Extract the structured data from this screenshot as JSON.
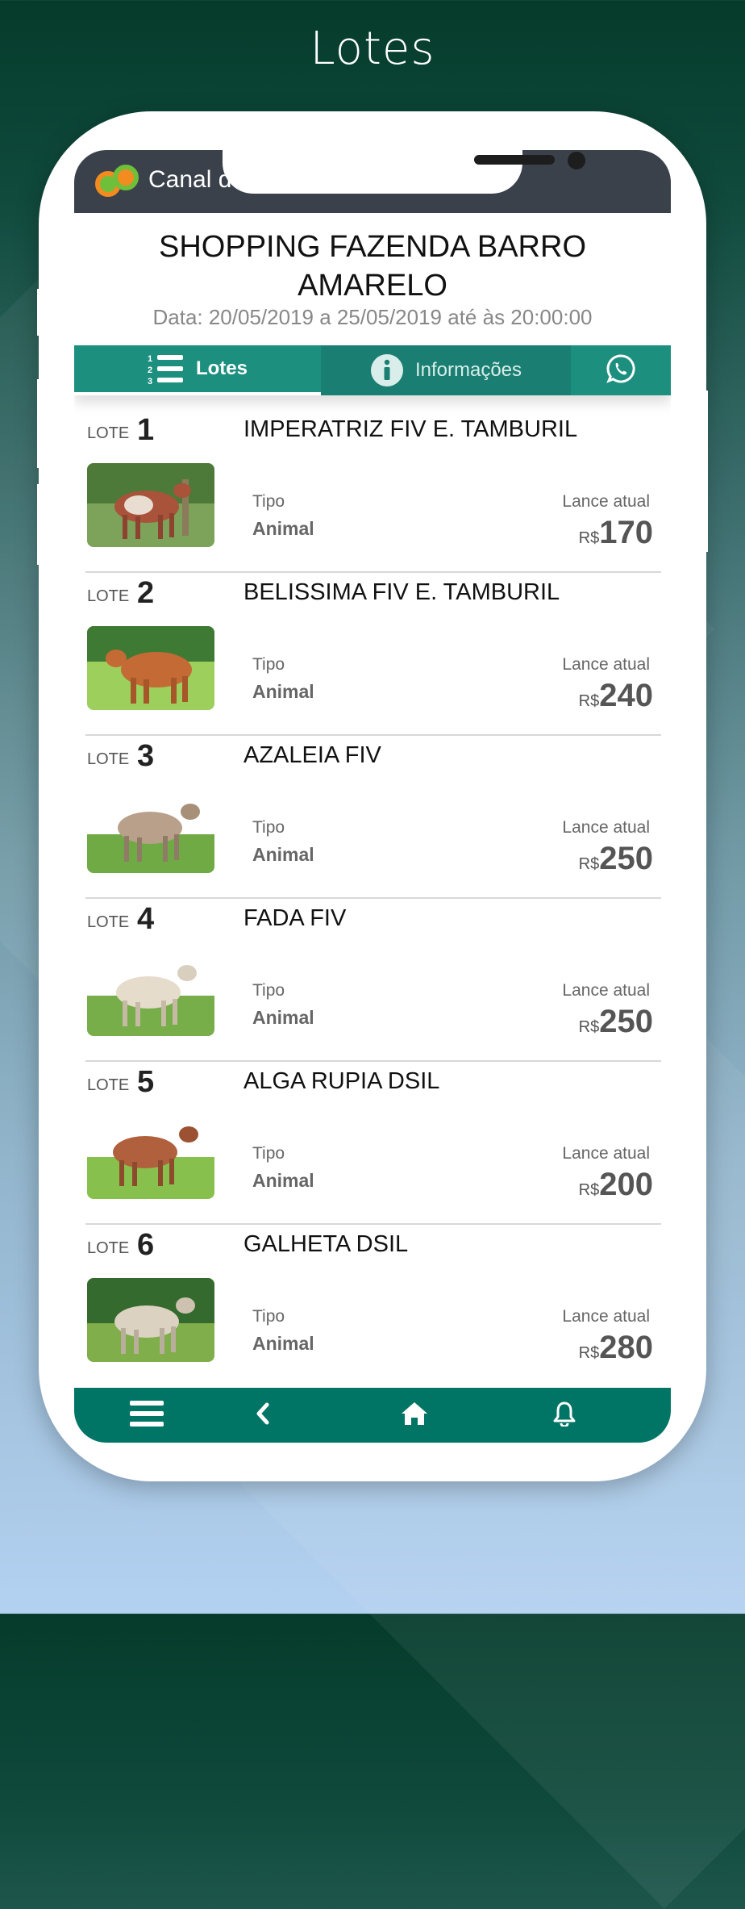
{
  "page_title": "Lotes",
  "app": {
    "name": "Canal do Leilão"
  },
  "auction": {
    "title": "SHOPPING FAZENDA BARRO AMARELO",
    "date": "Data: 20/05/2019 a 25/05/2019 até às 20:00:00"
  },
  "tabs": {
    "lotes": "Lotes",
    "informacoes": "Informações"
  },
  "lot_common": {
    "lote_label": "LOTE",
    "tipo_label": "Tipo",
    "lance_label": "Lance atual",
    "currency": "R$"
  },
  "lots": [
    {
      "number": "1",
      "name": "IMPERATRIZ FIV E. TAMBURIL",
      "tipo": "Animal",
      "price": "170"
    },
    {
      "number": "2",
      "name": "BELISSIMA FIV E. TAMBURIL",
      "tipo": "Animal",
      "price": "240"
    },
    {
      "number": "3",
      "name": "AZALEIA FIV",
      "tipo": "Animal",
      "price": "250"
    },
    {
      "number": "4",
      "name": "FADA FIV",
      "tipo": "Animal",
      "price": "250"
    },
    {
      "number": "5",
      "name": "ALGA RUPIA DSIL",
      "tipo": "Animal",
      "price": "200"
    },
    {
      "number": "6",
      "name": "GALHETA DSIL",
      "tipo": "Animal",
      "price": "280"
    }
  ],
  "icons": {
    "tab_lotes": "numbered-list-icon",
    "tab_info": "info-icon",
    "tab_whatsapp": "whatsapp-icon",
    "nav": [
      "menu-icon",
      "back-icon",
      "home-icon",
      "bell-icon"
    ]
  },
  "colors": {
    "primary": "#1d8f7f",
    "nav": "#007566",
    "header": "#3a414a"
  }
}
